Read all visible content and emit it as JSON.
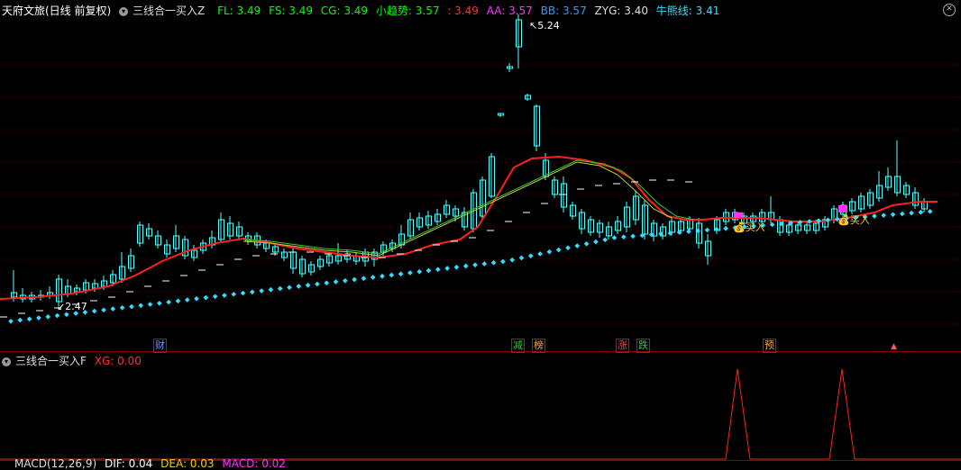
{
  "main_header": {
    "stock_name": "天府文旅(日线 前复权)",
    "indicator_name": "三线合一买入Z",
    "values": [
      {
        "label": "FL: 3.49",
        "color": "#00ff00"
      },
      {
        "label": "FS: 3.49",
        "color": "#00ff00"
      },
      {
        "label": "CG: 3.49",
        "color": "#00ff00"
      },
      {
        "label": "小趋势: 3.57",
        "color": "#00ff00"
      },
      {
        "label": ": 3.49",
        "color": "#ff3030"
      },
      {
        "label": "AA: 3.57",
        "color": "#ff33ff"
      },
      {
        "label": "BB: 3.57",
        "color": "#3399ff"
      },
      {
        "label": "ZYG: 3.40",
        "color": "#dddddd"
      },
      {
        "label": "牛熊线: 3.41",
        "color": "#33ddff"
      }
    ]
  },
  "annotations": {
    "high_label": "5.24",
    "low_label": "2.47",
    "buy_label_1": "买入",
    "buy_label_2": "买入"
  },
  "event_badges": [
    {
      "text": "财",
      "color": "#6699ff"
    },
    {
      "text": "减",
      "color": "#33cc33"
    },
    {
      "text": "榜",
      "color": "#ffaa33"
    },
    {
      "text": "涨",
      "color": "#ff4444"
    },
    {
      "text": "跌",
      "color": "#33cc33"
    },
    {
      "text": "预",
      "color": "#ffaa33"
    }
  ],
  "sub_header": {
    "indicator_name": "三线合一买入F",
    "value_label": "XG: 0.00",
    "value_color": "#ff3030"
  },
  "macd_header": {
    "label": "MACD(12,26,9)",
    "dif": "DIF: 0.04",
    "dea": "DEA: 0.03",
    "macd": "MACD: 0.02"
  },
  "colors": {
    "up": "#ff2020",
    "down": "#55ffff",
    "ma_red": "#ff2020",
    "dots": "#33ddff",
    "grid": "#8b0000"
  }
}
